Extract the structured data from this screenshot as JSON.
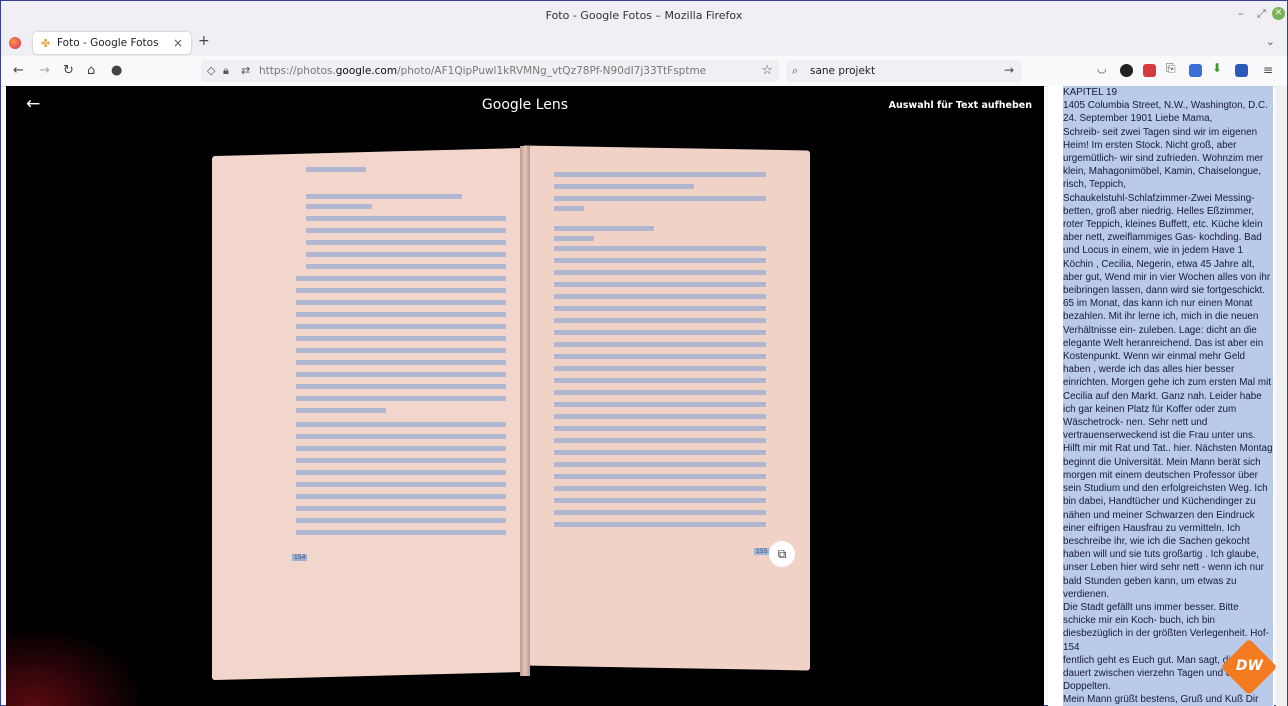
{
  "window": {
    "title": "Foto - Google Fotos – Mozilla Firefox"
  },
  "tab": {
    "label": "Foto - Google Fotos",
    "favicon": "google-photos-icon"
  },
  "nav": {
    "url_prefix": "https://photos.",
    "url_domain": "google.com",
    "url_path": "/photo/AF1QipPuwl1kRVMNg_vtQz78Pf-N90dI7j33TtFsptme",
    "search_value": "sane projekt"
  },
  "lens": {
    "brand": "Google Lens",
    "deselect_label": "Auswahl für Text aufheben",
    "left_page_number": "154",
    "right_page_number": "155"
  },
  "side_text": "KAPITEL 19\n1405 Columbia Street, N.W., Washington, D.C. 24. September 1901 Liebe Mama,\nSchreib- seit zwei Tagen sind wir im eigenen Heim! Im ersten Stock. Nicht groß, aber urgemütlich- wir sind zufrieden. Wohnzim mer klein, Mahagonimöbel, Kamin, Chaiselongue, risch, Teppich,\nSchaukelstuhl-Schlafzimmer-Zwei Messing- betten, groß aber niedrig. Helles Eßzimmer, roter Teppich, kleines Buffett, etc. Küche klein aber nett, zweiflammiges Gas- kochding. Bad und Locus in einem, wie in jedem Have 1 Köchin , Cecilia, Negerin, etwa 45 Jahre alt, aber gut, Wend mir in vier Wochen alles von ihr beibringen lassen, dann wird sie fortgeschickt. 65 im Monat, das kann ich nur einen Monat bezahlen. Mit ihr lerne ich, mich in die neuen Verhältnisse ein- zuleben. Lage: dicht an die elegante Welt heranreichend. Das ist aber ein Kostenpunkt. Wenn wir einmal mehr Geld haben , werde ich das alles hier besser einrichten. Morgen gehe ich zum ersten Mal mit Cecilia auf den Markt. Ganz nah. Leider habe ich gar keinen Platz für Koffer oder zum Wäschetrock- nen. Sehr nett und vertrauenserweckend ist die Frau unter uns. Hilft mir mit Rat und Tat.. hier. Nächsten Montag beginnt die Universität. Mein Mann berät sich morgen mit einem deutschen Professor über sein Studium und den erfolgreichsten Weg. Ich bin dabei, Handtücher und Küchendinger zu nähen und meiner Schwarzen den Eindruck einer eifrigen Hausfrau zu vermitteln. Ich beschreibe ihr, wie ich die Sachen gekocht haben will und sie tuts großartig . Ich glaube, unser Leben hier wird sehr nett - wenn ich nur bald Stunden geben kann, um etwas zu verdienen.\nDie Stadt gefällt uns immer besser. Bitte schicke mir ein Koch- buch, ich bin diesbezüglich in der größten Verlegenheit. Hof- 154\nfentlich geht es Euch gut. Man sagt, die Post dauert zwischen vierzehn Tagen und drei Doppelten.\nMein Mann grüßt bestens, Gruß und Kuß Dir und Olga, Deine Lina.",
  "watermark": "DW",
  "colors": {
    "accent": "#7a9ed6",
    "selection": "#b9cbe8",
    "page": "#f2d6cc"
  }
}
